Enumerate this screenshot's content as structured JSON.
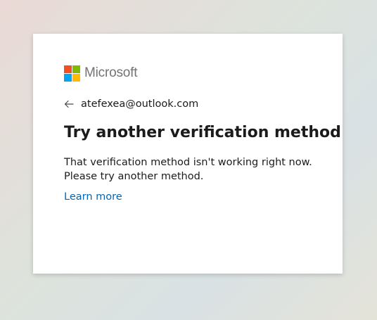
{
  "brand": {
    "name": "Microsoft",
    "colors": [
      "#f25022",
      "#7fba00",
      "#00a4ef",
      "#ffb900"
    ]
  },
  "identity": {
    "back_icon": "arrow-left-icon",
    "email": "atefexea@outlook.com"
  },
  "title": "Try another verification method",
  "description": {
    "line1": "That verification method isn't working right now.",
    "line2": "Please try another method."
  },
  "link": {
    "learn_more": "Learn more",
    "color": "#0067b8"
  }
}
